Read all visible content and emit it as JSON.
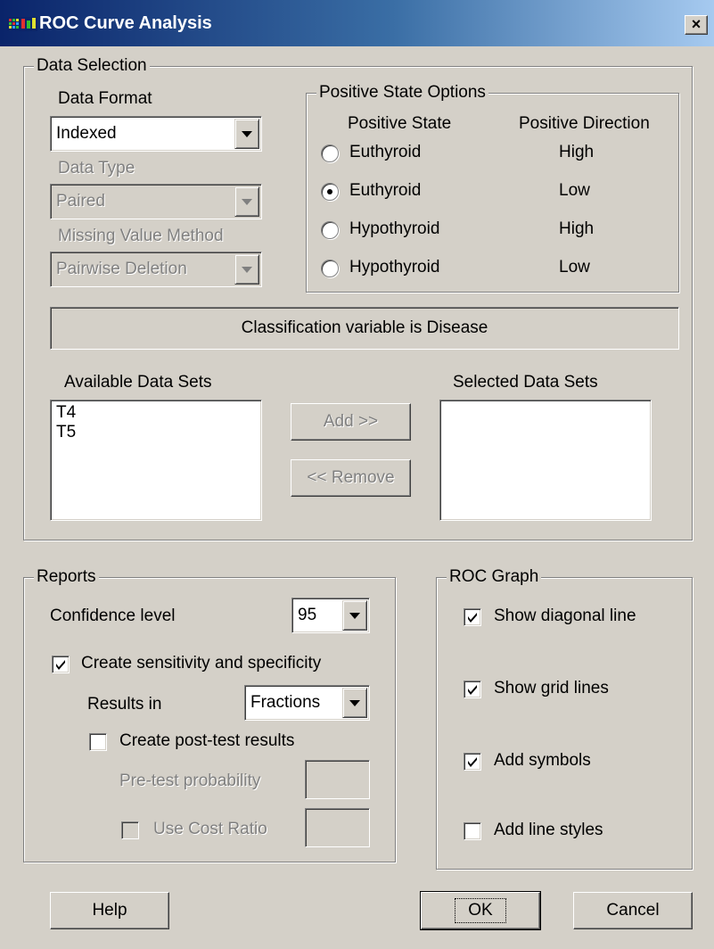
{
  "window": {
    "title": "ROC Curve Analysis",
    "close_glyph": "×"
  },
  "data_selection": {
    "legend": "Data Selection",
    "data_format": {
      "label": "Data Format",
      "value": "Indexed"
    },
    "data_type": {
      "label": "Data Type",
      "value": "Paired"
    },
    "missing_value": {
      "label": "Missing Value Method",
      "value": "Pairwise Deletion"
    },
    "positive_state_options": {
      "legend": "Positive State Options",
      "col_state": "Positive State",
      "col_direction": "Positive Direction",
      "options": [
        {
          "state": "Euthyroid",
          "direction": "High",
          "selected": false
        },
        {
          "state": "Euthyroid",
          "direction": "Low",
          "selected": true
        },
        {
          "state": "Hypothyroid",
          "direction": "High",
          "selected": false
        },
        {
          "state": "Hypothyroid",
          "direction": "Low",
          "selected": false
        }
      ]
    },
    "classification_text": "Classification variable is Disease",
    "available_label": "Available Data Sets",
    "available_items": [
      "T4",
      "T5"
    ],
    "selected_label": "Selected Data Sets",
    "add_button": "Add >>",
    "remove_button": "<< Remove"
  },
  "reports": {
    "legend": "Reports",
    "confidence_label": "Confidence level",
    "confidence_value": "95",
    "create_sens_spec": {
      "label": "Create sensitivity and specificity",
      "checked": true
    },
    "results_in_label": "Results in",
    "results_in_value": "Fractions",
    "create_post_test": {
      "label": "Create post-test results",
      "checked": false
    },
    "pretest_label": "Pre-test probability",
    "pretest_value": "",
    "use_cost_ratio": {
      "label": "Use Cost Ratio",
      "checked": false
    },
    "cost_ratio_value": ""
  },
  "roc_graph": {
    "legend": "ROC Graph",
    "show_diagonal": {
      "label": "Show diagonal line",
      "checked": true
    },
    "show_grid": {
      "label": "Show grid lines",
      "checked": true
    },
    "add_symbols": {
      "label": "Add symbols",
      "checked": true
    },
    "add_line_styles": {
      "label": "Add line styles",
      "checked": false
    }
  },
  "buttons": {
    "help": "Help",
    "ok": "OK",
    "cancel": "Cancel"
  },
  "colors": {
    "face": "#d4d0c8",
    "title_start": "#0a246a",
    "title_end": "#a6caf0",
    "disabled_text": "#808080"
  },
  "icons": [
    "app-icon",
    "close-icon",
    "dropdown-arrow-icon",
    "checkmark-icon",
    "radio-dot-icon"
  ]
}
